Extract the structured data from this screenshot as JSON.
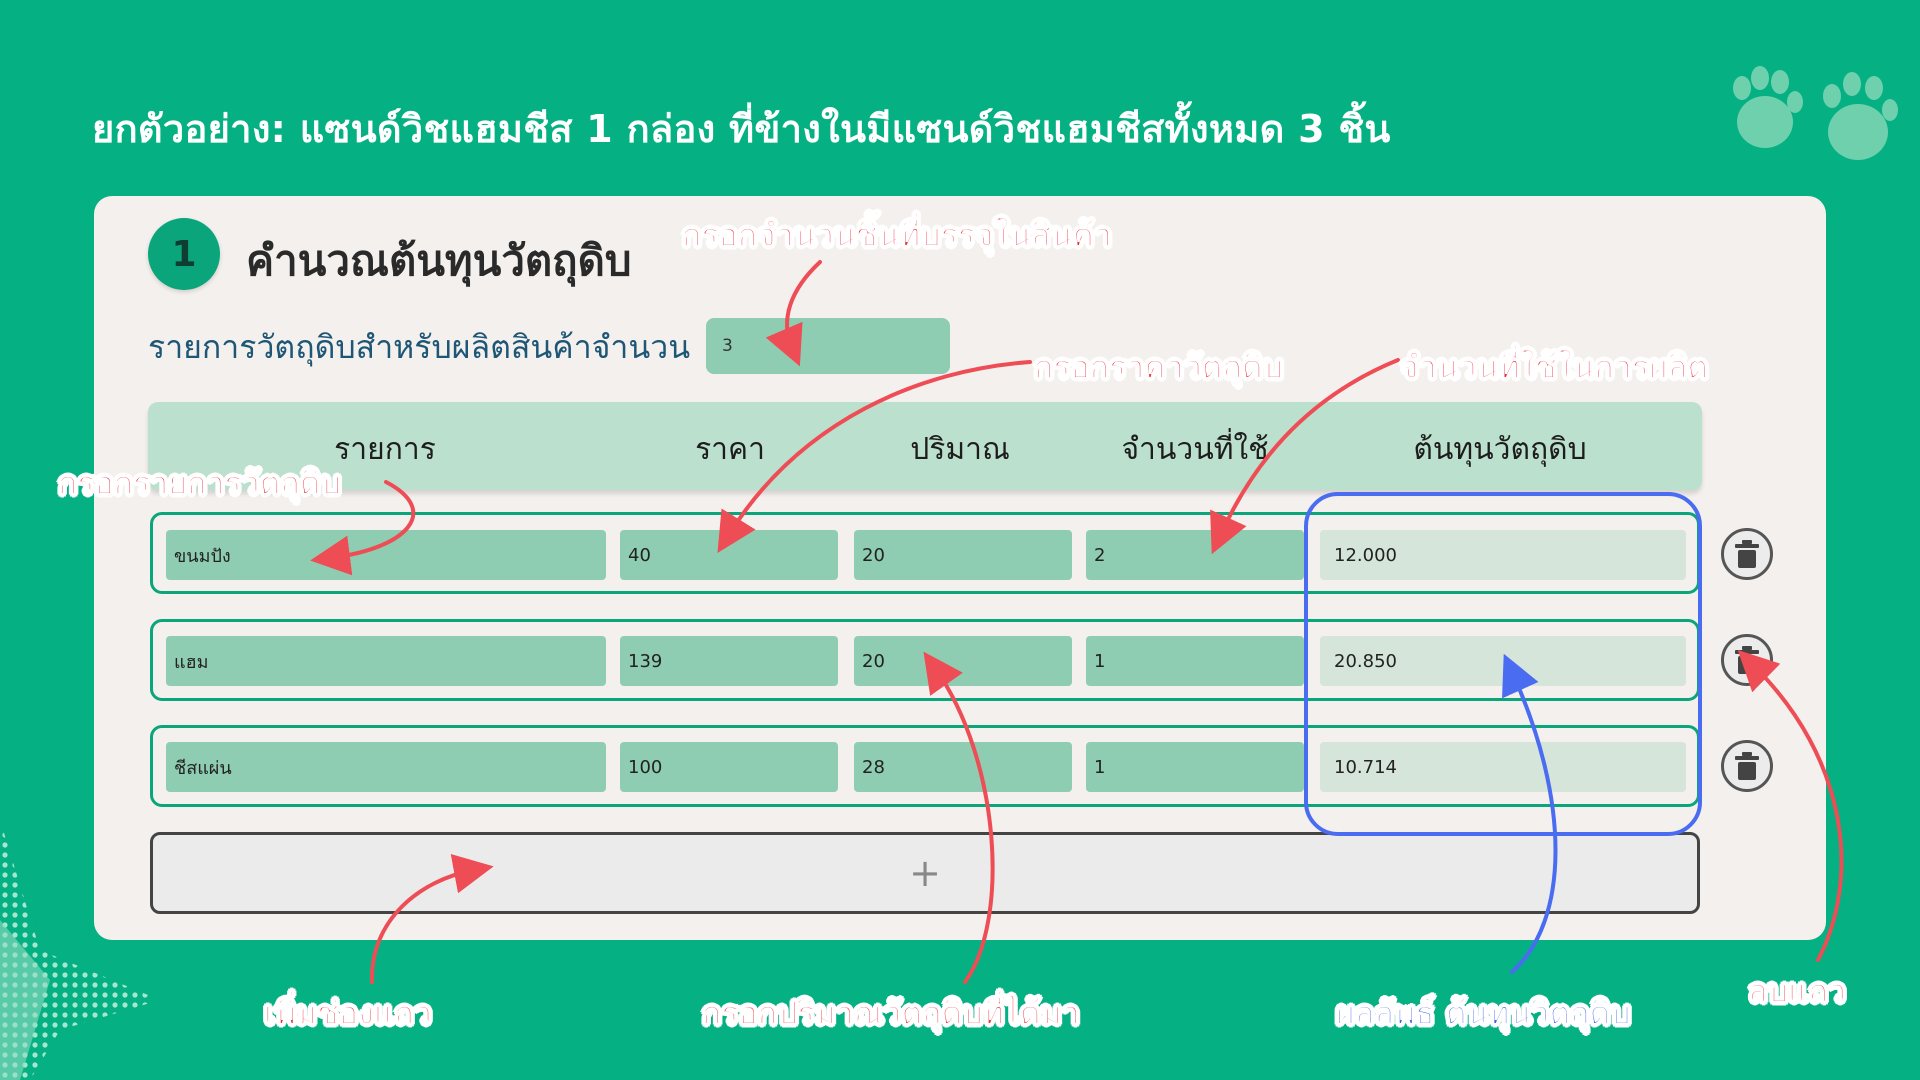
{
  "headline": "ยกตัวอย่าง: แซนด์วิชแฮมชีส 1 กล่อง ที่ข้างในมีแซนด์วิชแฮมชีสทั้งหมด 3 ชิ้น",
  "step": {
    "number": "1",
    "title": "คำนวณต้นทุนวัตถุดิบ"
  },
  "quantity": {
    "label": "รายการวัตถุดิบสำหรับผลิตสินค้าจำนวน",
    "value": "3"
  },
  "table": {
    "headers": [
      "รายการ",
      "ราคา",
      "ปริมาณ",
      "จำนวนที่ใช้",
      "ต้นทุนวัตถุดิบ"
    ],
    "rows": [
      {
        "item": "ขนมปัง",
        "price": "40",
        "amount": "20",
        "used": "2",
        "cost": "12.000"
      },
      {
        "item": "แฮม",
        "price": "139",
        "amount": "20",
        "used": "1",
        "cost": "20.850"
      },
      {
        "item": "ชีสแผ่น",
        "price": "100",
        "amount": "28",
        "used": "1",
        "cost": "10.714"
      }
    ],
    "add_label": "+"
  },
  "annotations": {
    "fill_pieces": "กรอกจำนวนชิ้นที่บรรจุในสินค้า",
    "fill_price": "กรอกราคาวัตถุดิบ",
    "used_in_production": "จำนวนที่ใช้ในการผลิต",
    "fill_item": "กรอกรายการวัตถุดิบ",
    "add_row": "เพิ่มช่องแถว",
    "fill_amount": "กรอกปริมาณวัตถุดิบที่ได้มา",
    "result_cost": "ผลลัพธ์ ต้นทุนวิตถุดิบ",
    "delete_row": "ลบแถว"
  },
  "colors": {
    "background": "#05b083",
    "card": "#f3f0ed",
    "accent": "#0aa57a",
    "input": "#8ecdb1",
    "header": "#bbe0ce",
    "annotation_red": "#ee2b39",
    "annotation_blue": "#3d5ce6"
  },
  "icons": {
    "logo": "paw-prints-icon",
    "delete": "trash-icon",
    "add": "plus-icon"
  }
}
